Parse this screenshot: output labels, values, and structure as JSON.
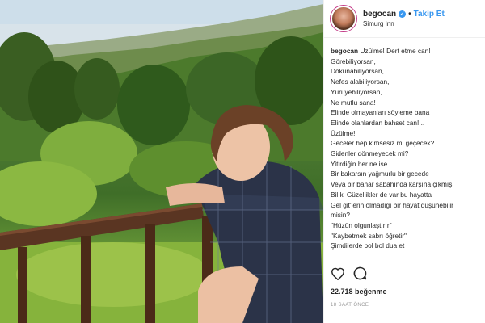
{
  "header": {
    "username": "begocan",
    "follow_label": "Takip Et",
    "separator": "•",
    "location": "Simurg Inn"
  },
  "caption": {
    "username": "begocan",
    "lines": [
      "Üzülme! Dert etme can!",
      "Görebiliyorsan,",
      "Dokunabiliyorsan,",
      "Nefes alabiliyorsan,",
      "Yürüyebiliyorsan,",
      "Ne mutlu sana!",
      "Elinde olmayanları söyleme bana",
      "Elinde olanlardan bahset can!...",
      "Üzülme!",
      "Geceler hep kimsesiz mi geçecek?",
      "Gidenler dönmeyecek mi?",
      "Yitirdiğin her ne ise",
      "Bir bakarsın yağmurlu bir gecede",
      "Veya bir bahar sabahında karşına çıkmış",
      "Bil ki Güzellikler de var bu hayatta",
      "Gel git'lerin olmadığı bir hayat düşünebilir",
      "misin?",
      "\"Hüzün olgunlaştırır\"",
      "\"Kaybetmek sabrı öğretir\"",
      "Şimdilerde bol bol dua et"
    ]
  },
  "actions": {
    "icons": [
      "heart-icon",
      "comment-icon"
    ],
    "likes": "22.718 beğenme",
    "time": "18 SAAT ÖNCE"
  },
  "colors": {
    "link_blue": "#3897f0",
    "text": "#262626",
    "muted": "#999999"
  }
}
